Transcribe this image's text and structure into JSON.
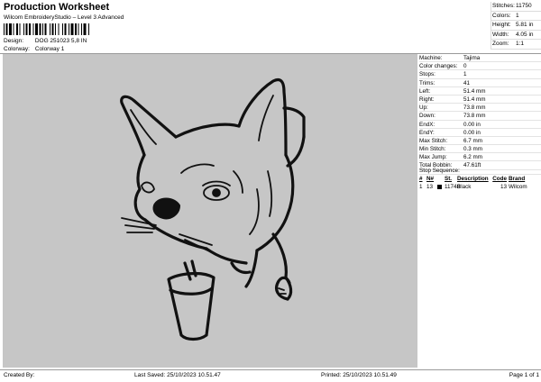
{
  "header": {
    "title": "Production Worksheet",
    "subtitle": "Wilcom EmbroideryStudio – Level 3 Advanced",
    "design_label": "Design:",
    "design_value": "DOG 251023 5,8 IN",
    "colorway_label": "Colorway:",
    "colorway_value": "Colorway 1"
  },
  "summary": [
    {
      "label": "Stitches:",
      "value": "11750"
    },
    {
      "label": "Colors:",
      "value": "1"
    },
    {
      "label": "Height:",
      "value": "5.81 in"
    },
    {
      "label": "Width:",
      "value": "4.05 in"
    },
    {
      "label": "Zoom:",
      "value": "1:1"
    }
  ],
  "machine": [
    {
      "label": "Machine:",
      "value": "Tajima"
    },
    {
      "label": "Color changes:",
      "value": "0"
    },
    {
      "label": "Stops:",
      "value": "1"
    },
    {
      "label": "Trims:",
      "value": "41"
    },
    {
      "label": "Left:",
      "value": "51.4 mm"
    },
    {
      "label": "Right:",
      "value": "51.4 mm"
    },
    {
      "label": "Up:",
      "value": "73.8 mm"
    },
    {
      "label": "Down:",
      "value": "73.8 mm"
    },
    {
      "label": "EndX:",
      "value": "0.00 in"
    },
    {
      "label": "EndY:",
      "value": "0.00 in"
    },
    {
      "label": "Max Stitch:",
      "value": "6.7 mm"
    },
    {
      "label": "Min Stitch:",
      "value": "0.3 mm"
    },
    {
      "label": "Max Jump:",
      "value": "6.2 mm"
    },
    {
      "label": "Total Bobbin:",
      "value": "47.61ft"
    }
  ],
  "stop_sequence": {
    "title": "Stop Sequence:",
    "columns": [
      "#",
      "N#",
      "",
      "St.",
      "Description",
      "Code",
      "Brand"
    ],
    "rows": [
      {
        "num": "1",
        "needle": "13",
        "stitches": "11748",
        "description": "Black",
        "code": "13",
        "brand": "Wilcom",
        "color": "#000000"
      }
    ]
  },
  "footer": {
    "created_by": "Created By:",
    "last_saved": "Last Saved: 25/10/2023 10.51.47",
    "printed": "Printed: 25/10/2023 10.51.49",
    "page": "Page 1 of 1"
  }
}
